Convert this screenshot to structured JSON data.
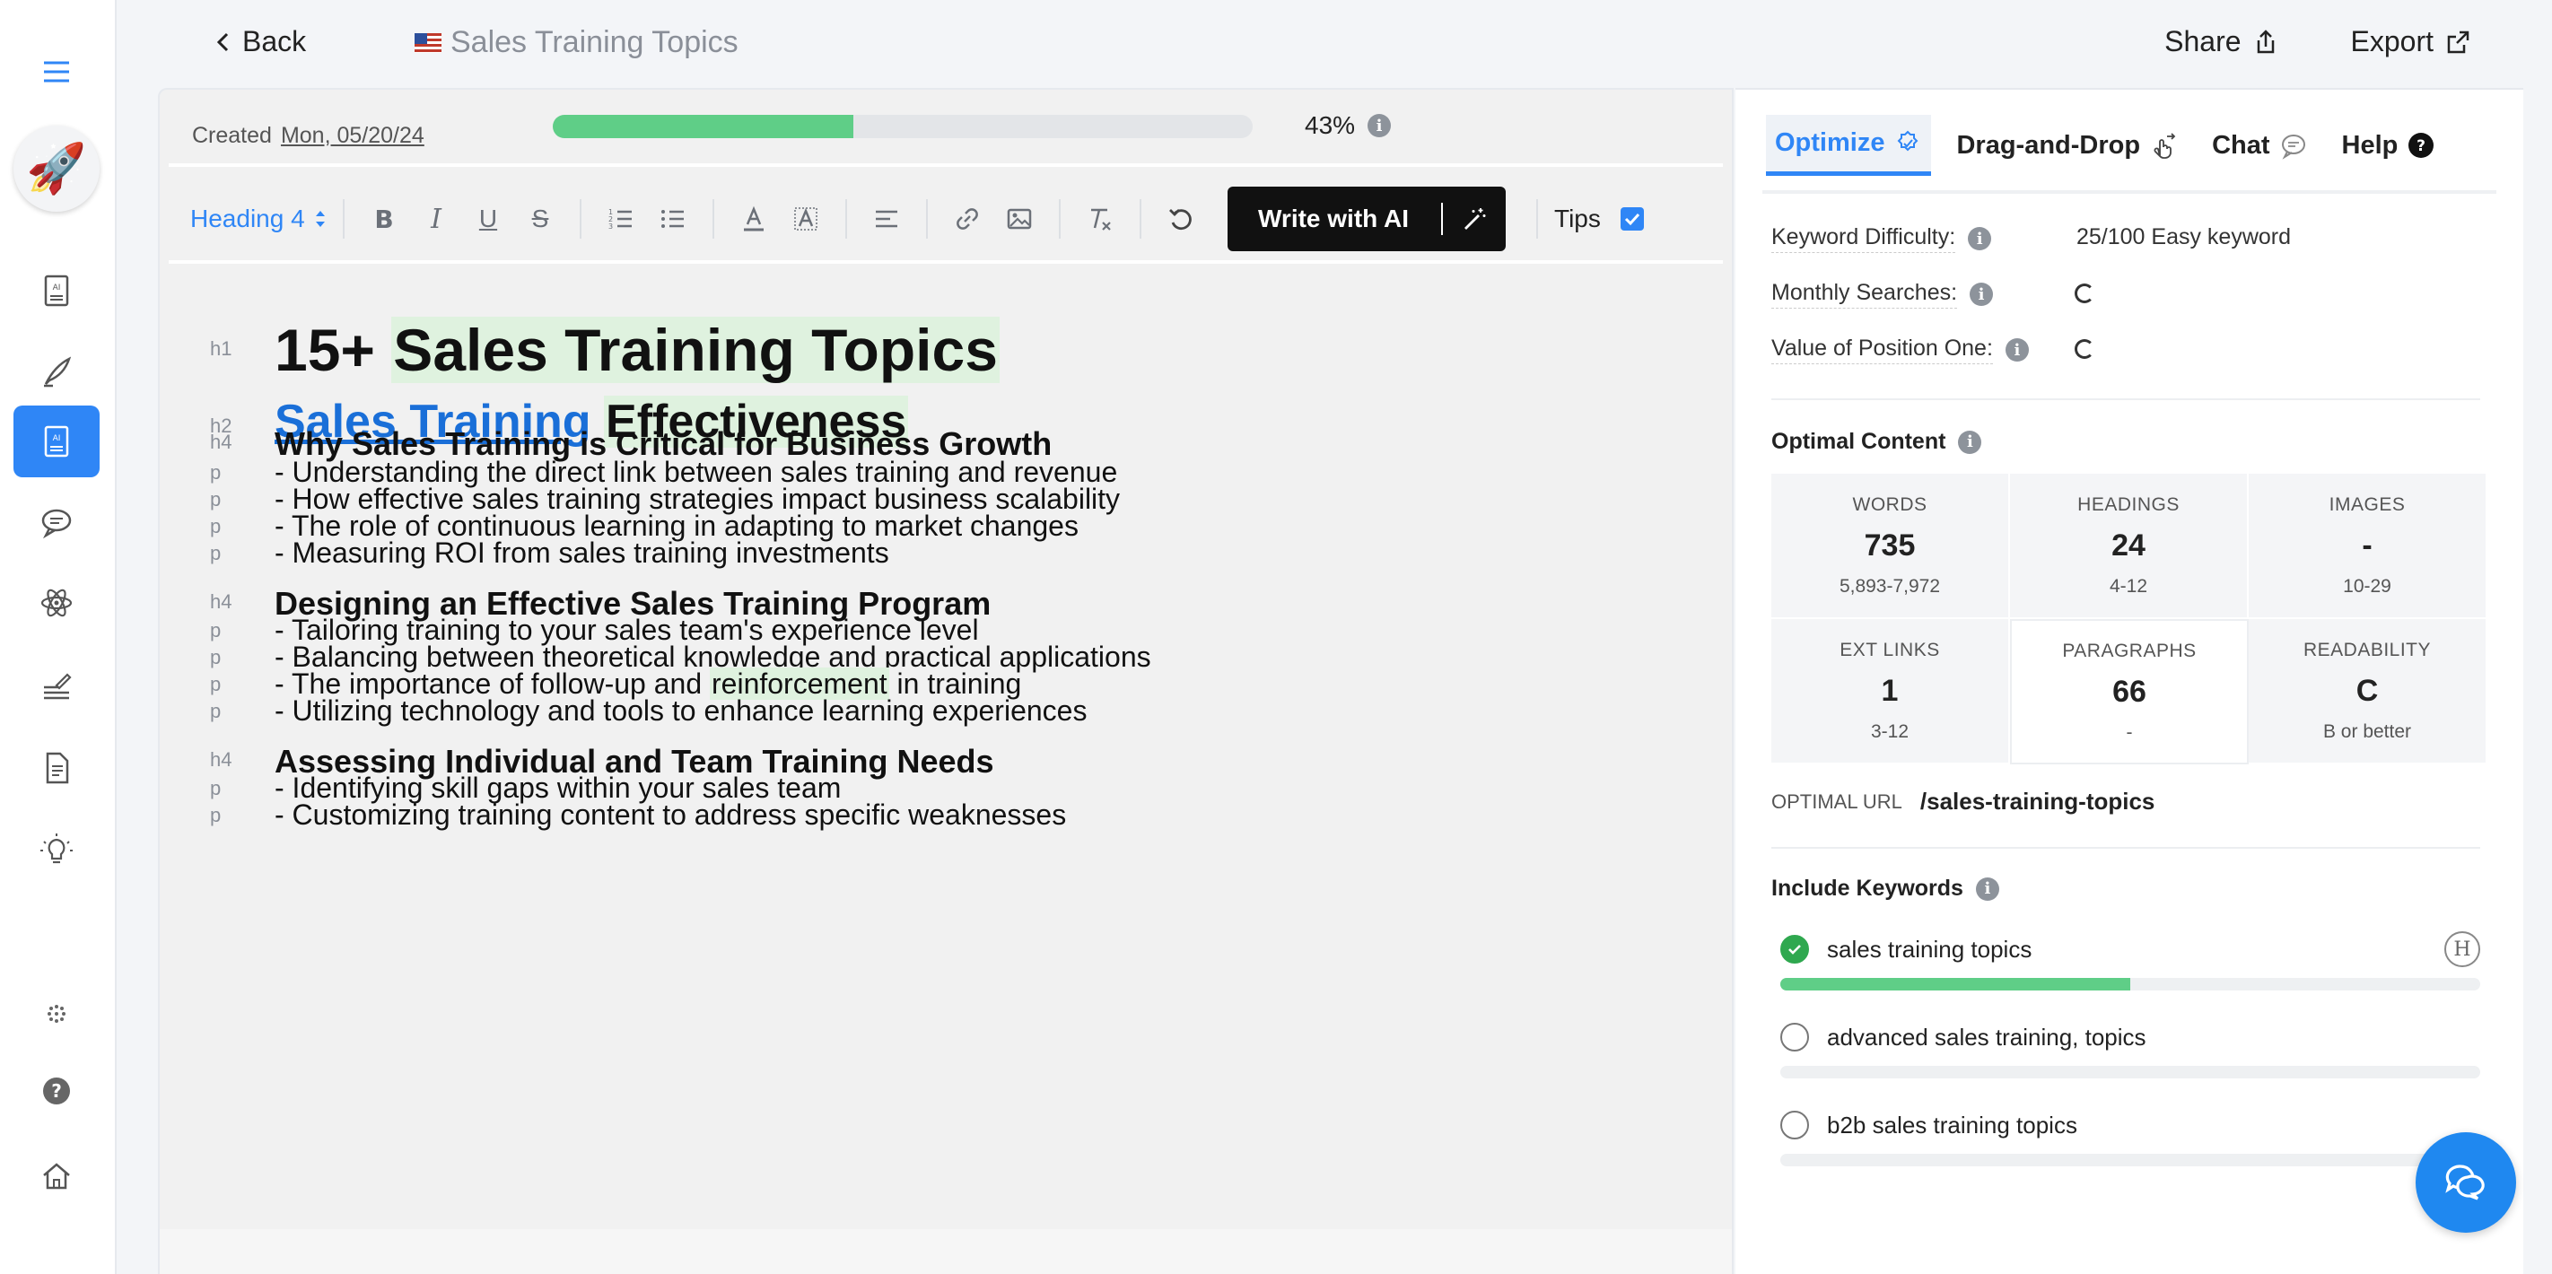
{
  "header": {
    "back_label": "Back",
    "doc_title": "Sales Training Topics",
    "share_label": "Share",
    "export_label": "Export"
  },
  "editor": {
    "created_label": "Created",
    "created_date": "Mon, 05/20/24",
    "progress_percent": 43,
    "progress_label": "43%",
    "toolbar": {
      "heading_select": "Heading 4",
      "write_ai_label": "Write with AI",
      "tips_label": "Tips",
      "tips_checked": true
    },
    "lines": [
      {
        "tag": "h1",
        "pre": "15+ ",
        "hl": "Sales Training Topics",
        "post": ""
      },
      {
        "tag": "h2",
        "link": "Sales Training",
        "hl": "Effectiveness"
      },
      {
        "tag": "h4",
        "text": "Why Sales Training is Critical for Business Growth"
      },
      {
        "tag": "p",
        "text": "- Understanding the direct link between sales training and revenue"
      },
      {
        "tag": "p",
        "text": "- How effective sales training strategies impact business scalability"
      },
      {
        "tag": "p",
        "text": "- The role of continuous learning in adapting to market changes"
      },
      {
        "tag": "p",
        "text": "- Measuring ROI from sales training investments"
      },
      {
        "tag": "h4",
        "text": "Designing an Effective Sales Training Program"
      },
      {
        "tag": "p",
        "text": "- Tailoring training to your sales team's experience level"
      },
      {
        "tag": "p",
        "text": "- Balancing between theoretical knowledge and practical applications"
      },
      {
        "tag": "p",
        "pre": "- The importance of follow-up and ",
        "hl": "reinforcement",
        "post": " in training"
      },
      {
        "tag": "p",
        "text": "- Utilizing technology and tools to enhance learning experiences"
      },
      {
        "tag": "h4",
        "text": "Assessing Individual and Team Training Needs"
      },
      {
        "tag": "p",
        "text": "- Identifying skill gaps within your sales team"
      },
      {
        "tag": "p",
        "text": "- Customizing training content to address specific weaknesses"
      }
    ]
  },
  "panel": {
    "tabs": [
      "Optimize",
      "Drag-and-Drop",
      "Chat",
      "Help"
    ],
    "keyword_difficulty_label": "Keyword Difficulty:",
    "keyword_difficulty_value": "25/100 Easy keyword",
    "monthly_searches_label": "Monthly Searches:",
    "value_position_label": "Value of Position One:",
    "optimal_content_title": "Optimal Content",
    "metrics": [
      {
        "label": "WORDS",
        "value": "735",
        "range": "5,893-7,972"
      },
      {
        "label": "HEADINGS",
        "value": "24",
        "range": "4-12"
      },
      {
        "label": "IMAGES",
        "value": "-",
        "range": "10-29"
      },
      {
        "label": "EXT LINKS",
        "value": "1",
        "range": "3-12"
      },
      {
        "label": "PARAGRAPHS",
        "value": "66",
        "range": "-"
      },
      {
        "label": "READABILITY",
        "value": "C",
        "range": "B or better"
      }
    ],
    "optimal_url_label": "OPTIMAL URL",
    "optimal_url_value": "/sales-training-topics",
    "include_keywords_title": "Include Keywords",
    "keywords": [
      {
        "text": "sales training topics",
        "done": true,
        "progress": 0.5
      },
      {
        "text": "advanced sales training, topics",
        "done": false,
        "progress": 0
      },
      {
        "text": "b2b sales training topics",
        "done": false,
        "progress": 0
      }
    ],
    "heading_badge": "H"
  },
  "colors": {
    "accent": "#2f86f6",
    "progress_green": "#5fce87",
    "highlight": "#dff2df",
    "link": "#1a6fd8"
  }
}
